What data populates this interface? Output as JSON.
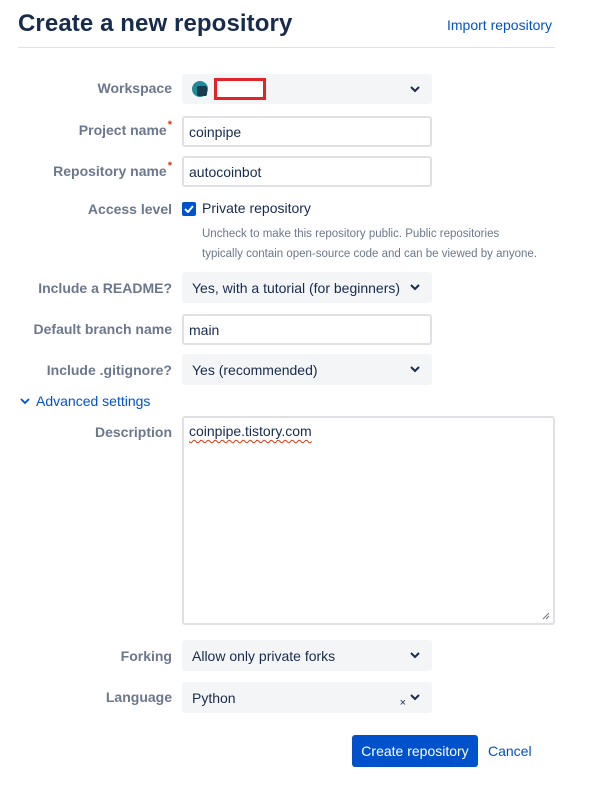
{
  "header": {
    "title": "Create a new repository",
    "import_link": "Import repository"
  },
  "form": {
    "workspace": {
      "label": "Workspace",
      "value": ""
    },
    "project_name": {
      "label": "Project name",
      "value": "coinpipe",
      "required_mark": "*"
    },
    "repository_name": {
      "label": "Repository name",
      "value": "autocoinbot",
      "required_mark": "*"
    },
    "access_level": {
      "label": "Access level",
      "checkbox_label": "Private repository",
      "checked": true,
      "help_line1": "Uncheck to make this repository public. Public repositories",
      "help_line2": "typically contain open-source code and can be viewed by anyone."
    },
    "readme": {
      "label": "Include a README?",
      "value": "Yes, with a tutorial (for beginners)"
    },
    "default_branch": {
      "label": "Default branch name",
      "value": "main"
    },
    "gitignore": {
      "label": "Include .gitignore?",
      "value": "Yes (recommended)"
    },
    "advanced": {
      "label": "Advanced settings",
      "expanded": true
    },
    "description": {
      "label": "Description",
      "value": "coinpipe.tistory.com"
    },
    "forking": {
      "label": "Forking",
      "value": "Allow only private forks"
    },
    "language": {
      "label": "Language",
      "value": "Python",
      "clear": "×"
    }
  },
  "actions": {
    "create_label": "Create repository",
    "cancel_label": "Cancel"
  },
  "icons": {
    "chevron": "chevron-down-icon",
    "check": "checkmark-icon",
    "workspace_avatar": "workspace-avatar-icon"
  },
  "colors": {
    "primary": "#0052CC",
    "text": "#172B4D",
    "label": "#6B778C",
    "field_bg": "#F4F5F7",
    "border": "#DFE1E6",
    "required": "#DE350B",
    "redaction": "#E2232A"
  }
}
